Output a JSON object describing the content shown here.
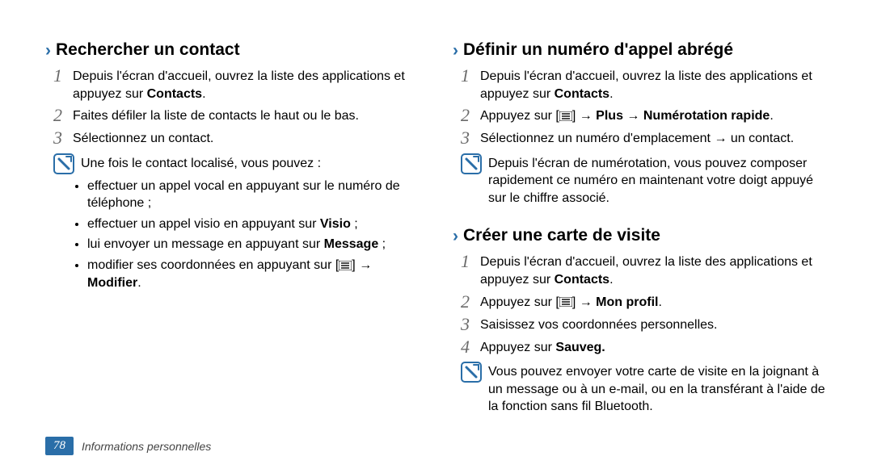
{
  "footer": {
    "pageNumber": "78",
    "sectionTitle": "Informations personnelles"
  },
  "icons": {
    "chevron": "›"
  },
  "left": {
    "heading": "Rechercher un contact",
    "steps": [
      "Depuis l'écran d'accueil, ouvrez la liste des applications et appuyez sur ",
      "Faites défiler la liste de contacts le haut ou le bas.",
      "Sélectionnez un contact."
    ],
    "step1_bold": "Contacts",
    "step1_tail": ".",
    "noteIntro": "Une fois le contact localisé, vous pouvez :",
    "bullets": {
      "b1": "effectuer un appel vocal en appuyant sur le numéro de téléphone ;",
      "b2_pre": "effectuer un appel visio en appuyant sur ",
      "b2_bold": "Visio",
      "b2_tail": " ;",
      "b3_pre": "lui envoyer un message en appuyant sur ",
      "b3_bold": "Message",
      "b3_tail": " ;",
      "b4_pre": "modifier ses coordonnées en appuyant sur [",
      "b4_mid": "] → ",
      "b4_bold": "Modifier",
      "b4_tail": "."
    }
  },
  "right": {
    "sec1": {
      "heading": "Définir un numéro d'appel abrégé",
      "step1_pre": "Depuis l'écran d'accueil, ouvrez la liste des applications et appuyez sur ",
      "step1_bold": "Contacts",
      "step1_tail": ".",
      "step2_pre": "Appuyez sur [",
      "step2_mid": "] → ",
      "step2_bold1": "Plus",
      "step2_arrow": " → ",
      "step2_bold2": "Numérotation rapide",
      "step2_tail": ".",
      "step3": "Sélectionnez un numéro d'emplacement → un contact.",
      "note": "Depuis l'écran de numérotation, vous pouvez composer rapidement ce numéro en maintenant votre doigt appuyé sur le chiffre associé."
    },
    "sec2": {
      "heading": "Créer une carte de visite",
      "step1_pre": "Depuis l'écran d'accueil, ouvrez la liste des applications et appuyez sur ",
      "step1_bold": "Contacts",
      "step1_tail": ".",
      "step2_pre": "Appuyez sur [",
      "step2_mid": "] → ",
      "step2_bold": "Mon profil",
      "step2_tail": ".",
      "step3": "Saisissez vos coordonnées personnelles.",
      "step4_pre": "Appuyez sur ",
      "step4_bold": "Sauveg.",
      "note": "Vous pouvez envoyer votre carte de visite en la joignant à un message ou à un e-mail, ou en la transférant à l'aide de la fonction sans fil Bluetooth."
    }
  }
}
